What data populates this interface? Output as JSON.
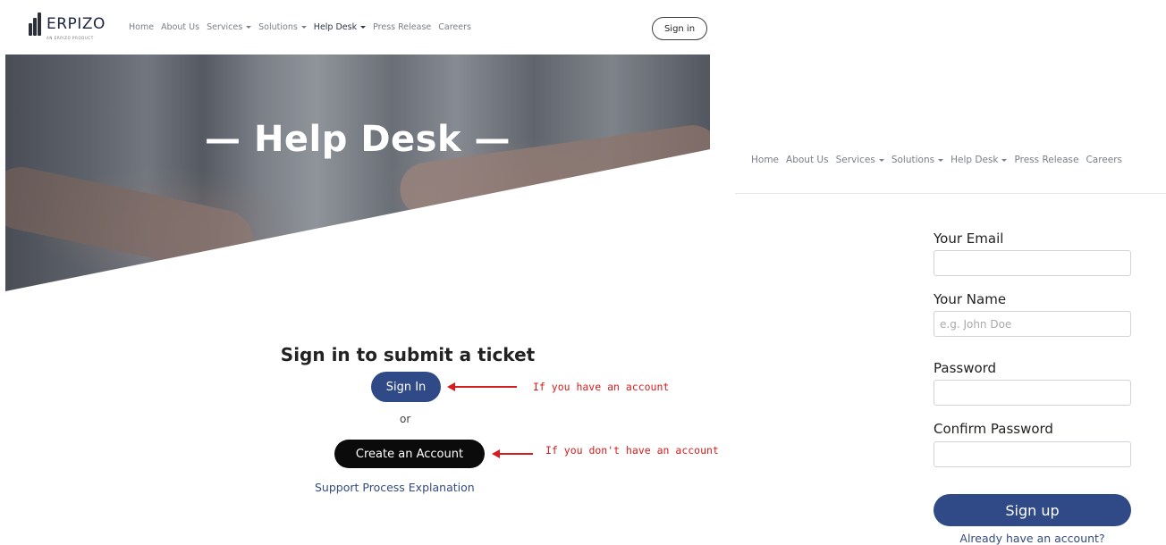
{
  "brand": {
    "name": "ERPIZO",
    "tagline": "AN ERPIZO PRODUCT"
  },
  "nav": [
    {
      "label": "Home",
      "dropdown": false
    },
    {
      "label": "About Us",
      "dropdown": false
    },
    {
      "label": "Services",
      "dropdown": true
    },
    {
      "label": "Solutions",
      "dropdown": true
    },
    {
      "label": "Help Desk",
      "dropdown": true
    },
    {
      "label": "Press Release",
      "dropdown": false
    },
    {
      "label": "Careers",
      "dropdown": false
    }
  ],
  "header": {
    "signin_label": "Sign in"
  },
  "hero": {
    "title": "— Help Desk —"
  },
  "ticket": {
    "heading": "Sign in to submit a ticket",
    "signin_button": "Sign In",
    "or_text": "or",
    "create_button": "Create an Account",
    "support_link": "Support Process Explanation"
  },
  "annotations": {
    "has_account": "If you have an account",
    "no_account": "If you don't have an account",
    "color": "#d61c1c"
  },
  "signup_form": {
    "email_label": "Your Email",
    "email_value": "",
    "name_label": "Your Name",
    "name_placeholder": "e.g. John Doe",
    "password_label": "Password",
    "confirm_label": "Confirm Password",
    "submit_label": "Sign up",
    "login_link": "Already have an account?"
  },
  "colors": {
    "primary": "#2f4a86",
    "dark_button": "#0b0b0b",
    "link": "#344b80"
  }
}
